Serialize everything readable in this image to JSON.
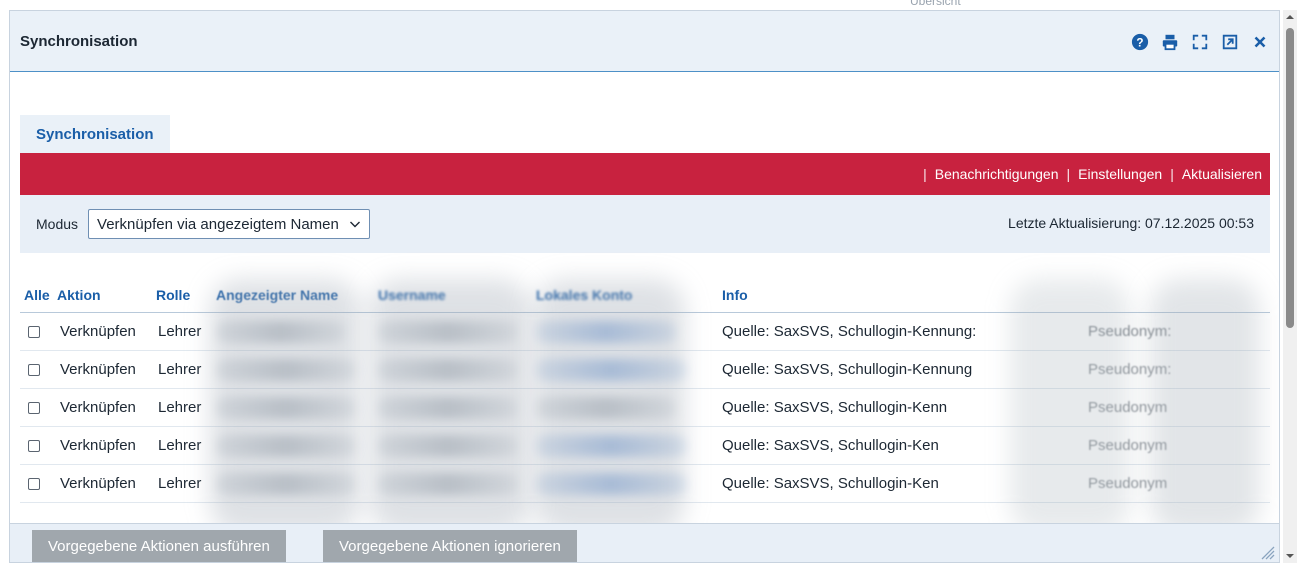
{
  "background": {
    "strip_text": "Übersicht"
  },
  "dialog": {
    "title": "Synchronisation",
    "tools": [
      {
        "name": "help-icon"
      },
      {
        "name": "print-icon"
      },
      {
        "name": "fullscreen-icon"
      },
      {
        "name": "open-external-icon"
      },
      {
        "name": "close-icon"
      }
    ]
  },
  "tab": {
    "label": "Synchronisation"
  },
  "actionbar": {
    "links": [
      "Benachrichtigungen",
      "Einstellungen",
      "Aktualisieren"
    ],
    "separator": "|",
    "color": "#c8223f"
  },
  "filter": {
    "label": "Modus",
    "selected": "Verknüpfen via angezeigtem Namen",
    "last_update": "Letzte Aktualisierung: 07.12.2025 00:53"
  },
  "table": {
    "headers": {
      "alle": "Alle",
      "aktion": "Aktion",
      "rolle": "Rolle",
      "angezeigter_name": "Angezeigter Name",
      "username": "Username",
      "lokales_konto": "Lokales Konto",
      "info": "Info"
    },
    "rows": [
      {
        "aktion": "Verknüpfen",
        "rolle": "Lehrer",
        "info": "Quelle: SaxSVS, Schullogin-Kennung:",
        "pseudonym": "Pseudonym:"
      },
      {
        "aktion": "Verknüpfen",
        "rolle": "Lehrer",
        "info": "Quelle: SaxSVS, Schullogin-Kennung",
        "pseudonym": "Pseudonym:"
      },
      {
        "aktion": "Verknüpfen",
        "rolle": "Lehrer",
        "info": "Quelle: SaxSVS, Schullogin-Kenn",
        "pseudonym": "Pseudonym"
      },
      {
        "aktion": "Verknüpfen",
        "rolle": "Lehrer",
        "info": "Quelle: SaxSVS, Schullogin-Ken",
        "pseudonym": "Pseudonym"
      },
      {
        "aktion": "Verknüpfen",
        "rolle": "Lehrer",
        "info": "Quelle: SaxSVS, Schullogin-Ken",
        "pseudonym": "Pseudonym"
      }
    ]
  },
  "footer": {
    "execute_label": "Vorgegebene Aktionen ausführen",
    "ignore_label": "Vorgegebene Aktionen ignorieren"
  }
}
